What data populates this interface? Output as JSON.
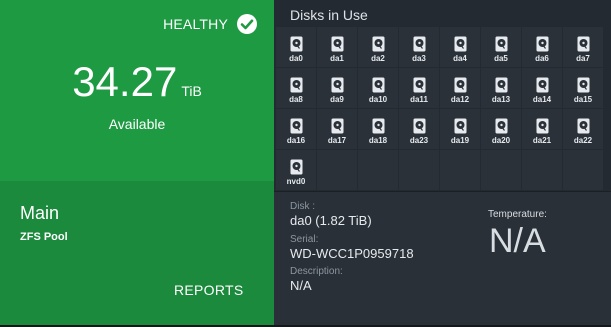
{
  "pool": {
    "status": "HEALTHY",
    "available_value": "34.27",
    "available_unit": "TiB",
    "available_label": "Available",
    "name": "Main",
    "type": "ZFS Pool",
    "reports_label": "REPORTS",
    "status_color": "#1e9a43"
  },
  "disks": {
    "title": "Disks in Use",
    "items": [
      "da0",
      "da1",
      "da2",
      "da3",
      "da4",
      "da5",
      "da6",
      "da7",
      "da8",
      "da9",
      "da10",
      "da11",
      "da12",
      "da13",
      "da14",
      "da15",
      "da16",
      "da17",
      "da18",
      "da23",
      "da19",
      "da20",
      "da21",
      "da22",
      "nvd0"
    ]
  },
  "details": {
    "disk_key": "Disk :",
    "disk_value": "da0 (1.82 TiB)",
    "serial_key": "Serial:",
    "serial_value": "WD-WCC1P0959718",
    "description_key": "Description:",
    "description_value": "N/A",
    "temperature_key": "Temperature:",
    "temperature_value": "N/A"
  }
}
